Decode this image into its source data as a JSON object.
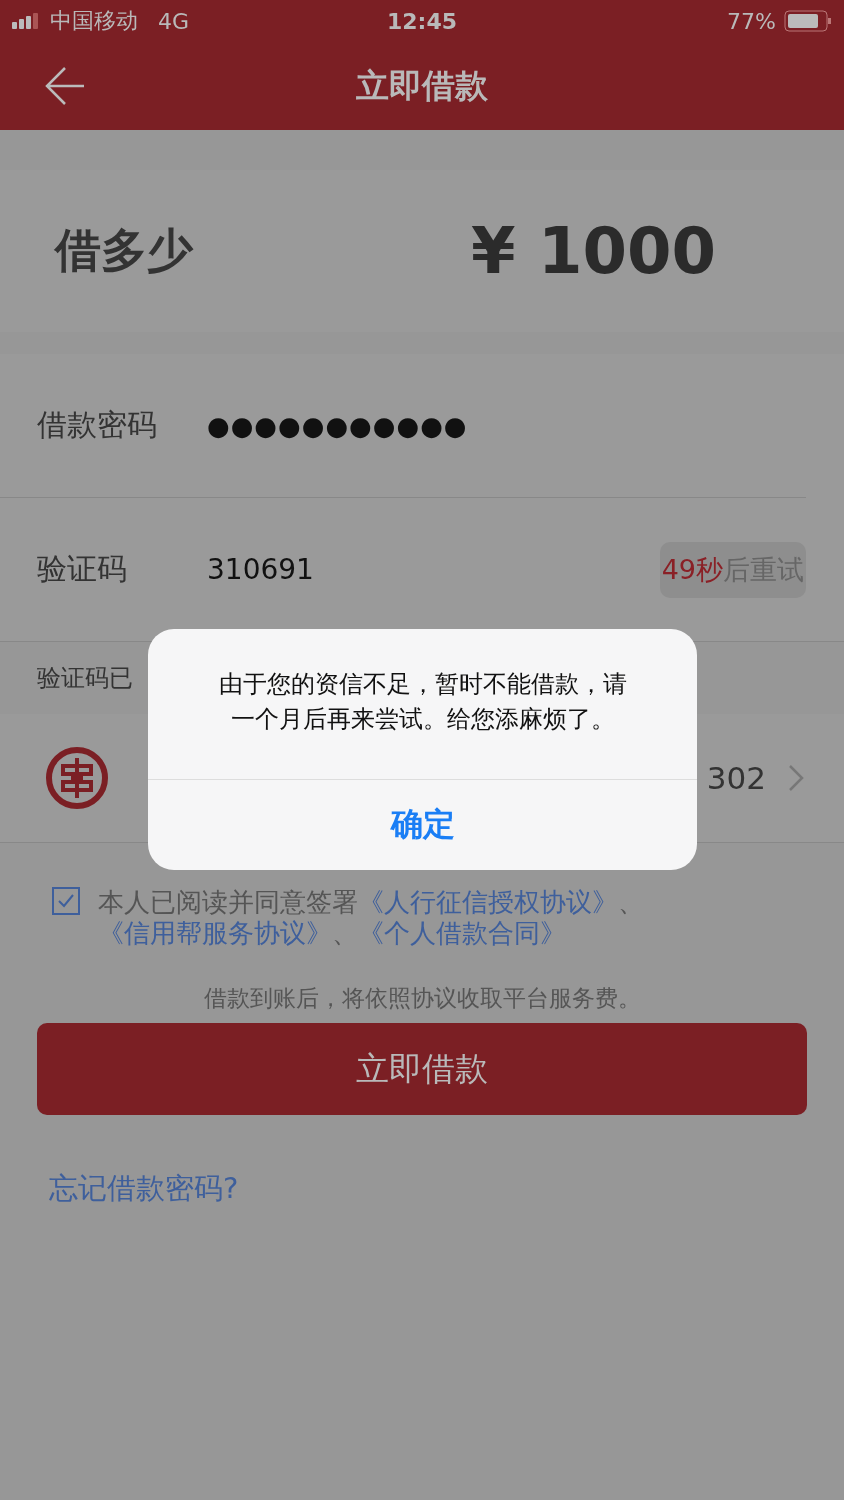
{
  "status_bar": {
    "carrier": "中国移动",
    "network": "4G",
    "time": "12:45",
    "battery": "77%"
  },
  "nav": {
    "title": "立即借款"
  },
  "amount": {
    "label": "借多少",
    "value": "¥ 1000"
  },
  "password": {
    "label": "借款密码",
    "value": "●●●●●●●●●●●"
  },
  "verification": {
    "label": "验证码",
    "value": "310691",
    "countdown": "49秒",
    "resend": "后重试",
    "hint": "验证码已"
  },
  "bank": {
    "card_tail": "302"
  },
  "agreement": {
    "checked": true,
    "text": "本人已阅读并同意签署",
    "links": [
      "《人行征信授权协议》",
      "《信用帮服务协议》",
      "《个人借款合同》"
    ],
    "separator": "、"
  },
  "fee_note": "借款到账后，将依照协议收取平台服务费。",
  "submit_button": "立即借款",
  "forgot_link": "忘记借款密码?",
  "dialog": {
    "message": "由于您的资信不足，暂时不能借款，请一个月后再来尝试。给您添麻烦了。",
    "button": "确定"
  }
}
